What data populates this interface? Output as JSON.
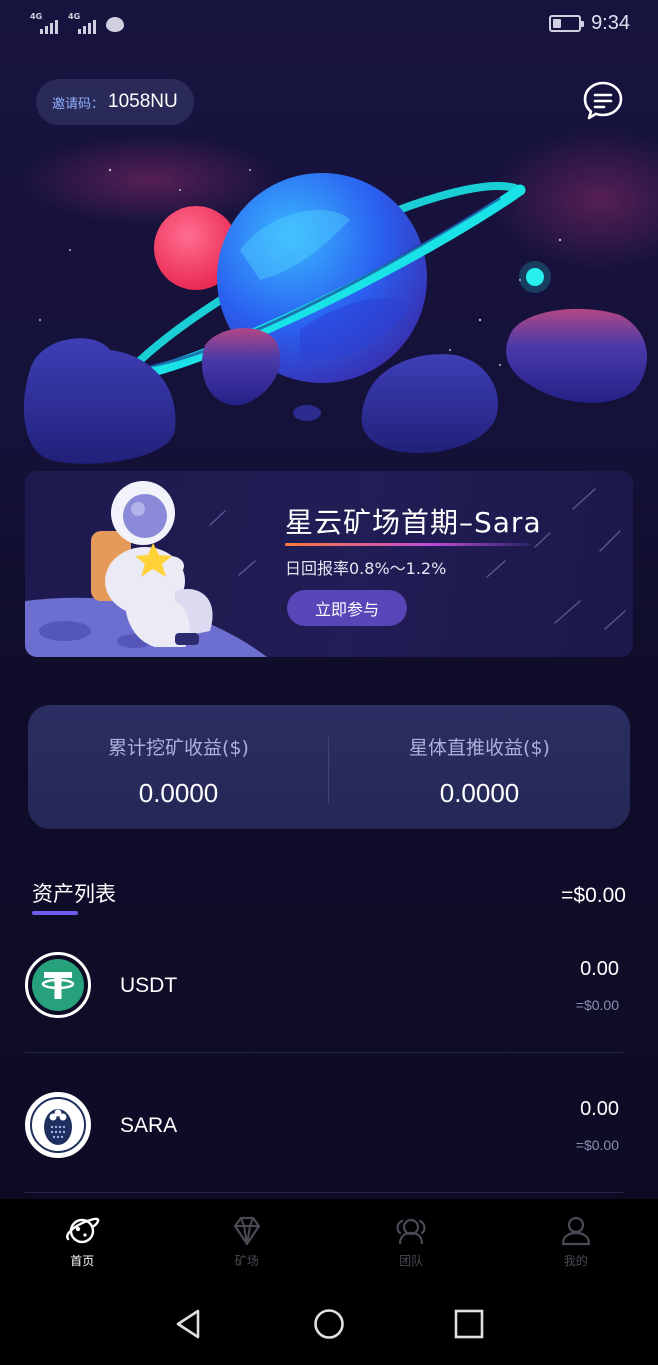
{
  "status_bar": {
    "network_1": "4G",
    "network_2": "4G",
    "time": "9:34",
    "icons": [
      "signal-icon",
      "signal-icon",
      "message-icon",
      "battery-icon"
    ]
  },
  "header": {
    "invite_label": "邀请码：",
    "invite_code": "1058NU",
    "message_icon": "message-icon"
  },
  "banner": {
    "title": "星云矿场首期–Sara",
    "subtitle": "日回报率0.8%～1.2%",
    "button_label": "立即参与"
  },
  "earnings": {
    "mining_label": "累计挖矿收益($)",
    "mining_value": "0.0000",
    "referral_label": "星体直推收益($)",
    "referral_value": "0.0000"
  },
  "assets": {
    "title": "资产列表",
    "total": "=$0.00",
    "items": [
      {
        "name": "USDT",
        "amount": "0.00",
        "usd": "=$0.00",
        "icon": "tether-icon",
        "color": "#26a17b"
      },
      {
        "name": "SARA",
        "amount": "0.00",
        "usd": "=$0.00",
        "icon": "sara-icon",
        "color": "#1e2f5e"
      }
    ]
  },
  "tabs": [
    {
      "label": "首页",
      "icon": "planet-icon",
      "active": true
    },
    {
      "label": "矿场",
      "icon": "diamond-icon",
      "active": false
    },
    {
      "label": "团队",
      "icon": "team-icon",
      "active": false
    },
    {
      "label": "我的",
      "icon": "profile-icon",
      "active": false
    }
  ],
  "nav": {
    "back_icon": "back-icon",
    "home_icon": "home-icon",
    "recents_icon": "recents-icon"
  },
  "colors": {
    "background": "#0d0b24",
    "accent": "#6d5ef0",
    "button": "#5a45b8",
    "ring_cyan": "#19e3e6",
    "planet_pink": "#ff3d6e"
  }
}
